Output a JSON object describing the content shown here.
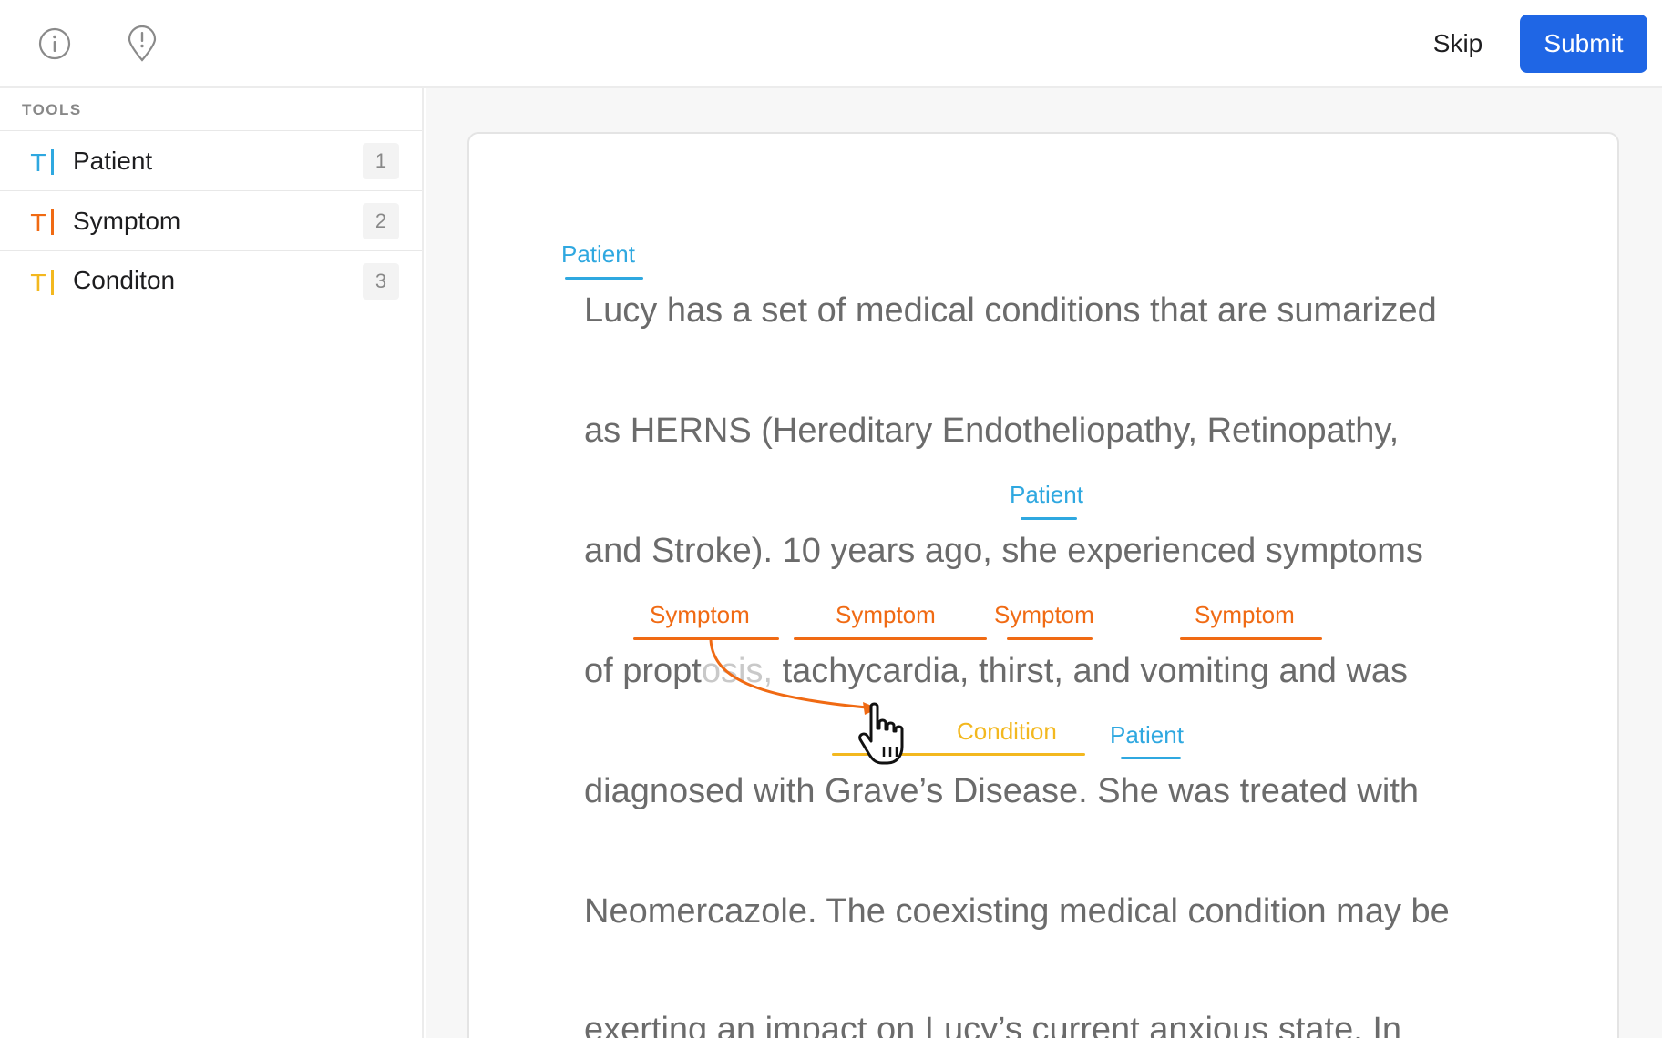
{
  "topbar": {
    "info_icon": "info-circle-icon",
    "issue_icon": "map-pin-alert-icon",
    "skip_label": "Skip",
    "submit_label": "Submit",
    "submit_color": "#1f66e5"
  },
  "sidebar": {
    "section_label": "TOOLS",
    "tools": [
      {
        "icon": "T",
        "name": "Patient",
        "key": "1",
        "color": "#2fa8e0"
      },
      {
        "icon": "T",
        "name": "Symptom",
        "key": "2",
        "color": "#f06a13"
      },
      {
        "icon": "T",
        "name": "Conditon",
        "key": "3",
        "color": "#f3b81f"
      }
    ]
  },
  "document": {
    "lines": [
      "Lucy has a set of medical conditions that are sumarized",
      "as HERNS (Hereditary Endotheliopathy, Retinopathy,",
      "and Stroke). 10 years ago, she experienced symptoms",
      "tachycardia, thirst, and vomiting and was",
      "diagnosed with Grave’s Disease. She was treated with",
      "Neomercazole. The coexisting medical condition may be",
      "exerting an impact on Lucy’s current anxious state. In"
    ],
    "line4_prefix": "of propt",
    "line4_faded": "osis,",
    "annotations": {
      "patient_1": "Patient",
      "patient_2": "Patient",
      "patient_3": "Patient",
      "symptom_1": "Symptom",
      "symptom_2": "Symptom",
      "symptom_3": "Symptom",
      "symptom_4": "Symptom",
      "condition_1": "Condition"
    }
  },
  "cursor_icon": "hand-pointer-icon"
}
